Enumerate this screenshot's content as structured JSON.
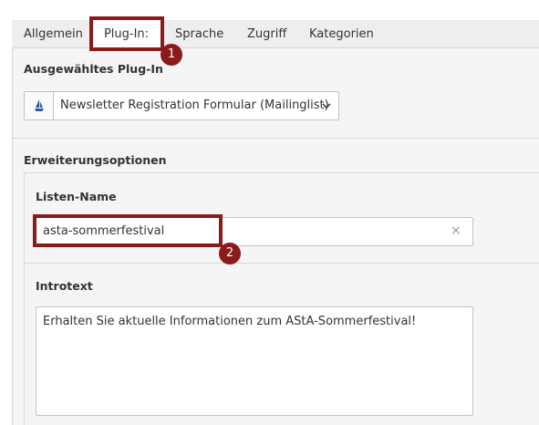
{
  "tabs": [
    {
      "label": "Allgemein"
    },
    {
      "label": "Plug-In:"
    },
    {
      "label": "Sprache"
    },
    {
      "label": "Zugriff"
    },
    {
      "label": "Kategorien"
    }
  ],
  "plugin_section": {
    "title": "Ausgewähltes Plug-In",
    "selected_value": "Newsletter Registration Formular (Mailinglist)",
    "icon": "mailing-ship-icon"
  },
  "extension_section": {
    "title": "Erweiterungsoptionen",
    "list_name": {
      "label": "Listen-Name",
      "value": "asta-sommerfestival",
      "clear_glyph": "×"
    },
    "introtext": {
      "label": "Introtext",
      "value": "Erhalten Sie aktuelle Informationen zum AStA-Sommerfestival!"
    }
  },
  "annotations": [
    {
      "number": "1"
    },
    {
      "number": "2"
    }
  ],
  "colors": {
    "highlight": "#8b1a1a",
    "background": "#f5f5f5"
  }
}
